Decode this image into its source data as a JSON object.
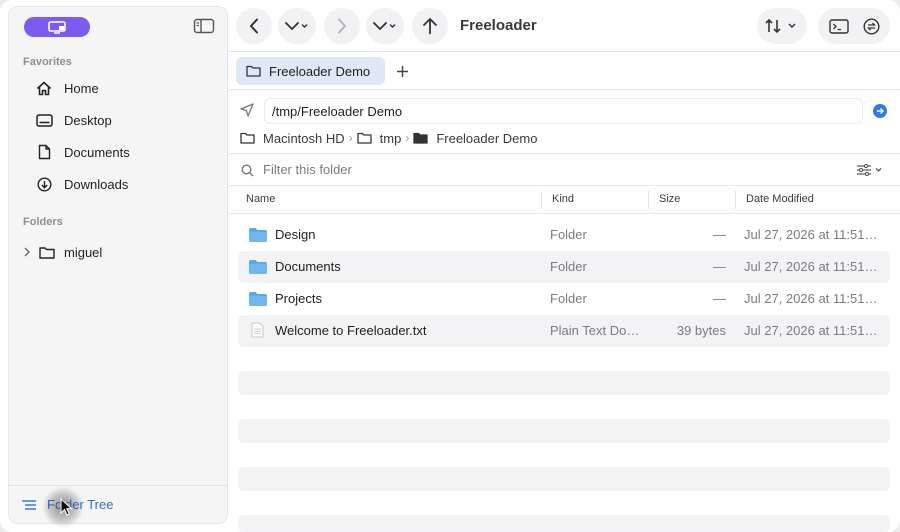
{
  "toolbar": {
    "title": "Freeloader"
  },
  "sidebar": {
    "favorites_label": "Favorites",
    "favorites": [
      {
        "label": "Home",
        "icon": "home-icon"
      },
      {
        "label": "Desktop",
        "icon": "desktop-icon"
      },
      {
        "label": "Documents",
        "icon": "document-icon"
      },
      {
        "label": "Downloads",
        "icon": "download-icon"
      }
    ],
    "folders_label": "Folders",
    "folders": [
      {
        "label": "miguel",
        "icon": "folder-icon"
      }
    ],
    "bottom_label": "Folder Tree"
  },
  "tabs": [
    {
      "label": "Freeloader Demo",
      "active": true
    }
  ],
  "path": {
    "value": "/tmp/Freeloader Demo",
    "breadcrumbs": [
      "Macintosh HD",
      "tmp",
      "Freeloader Demo"
    ]
  },
  "filter": {
    "placeholder": "Filter this folder"
  },
  "table": {
    "columns": [
      "Name",
      "Kind",
      "Size",
      "Date Modified"
    ],
    "rows": [
      {
        "name": "Design",
        "kind": "Folder",
        "size": "—",
        "date": "Jul 27, 2026 at 11:51…",
        "icon": "folder-icon"
      },
      {
        "name": "Documents",
        "kind": "Folder",
        "size": "—",
        "date": "Jul 27, 2026 at 11:51…",
        "icon": "folder-icon"
      },
      {
        "name": "Projects",
        "kind": "Folder",
        "size": "—",
        "date": "Jul 27, 2026 at 11:51…",
        "icon": "folder-icon"
      },
      {
        "name": "Welcome to Freeloader.txt",
        "kind": "Plain Text Do…",
        "size": "39 bytes",
        "date": "Jul 27, 2026 at 11:51…",
        "icon": "text-file-icon"
      }
    ]
  },
  "colors": {
    "accent": "#7a5cf0",
    "tab_active": "#dfe8f7",
    "folder_blue": "#5aa9e6",
    "link_blue": "#2f6fd6"
  }
}
